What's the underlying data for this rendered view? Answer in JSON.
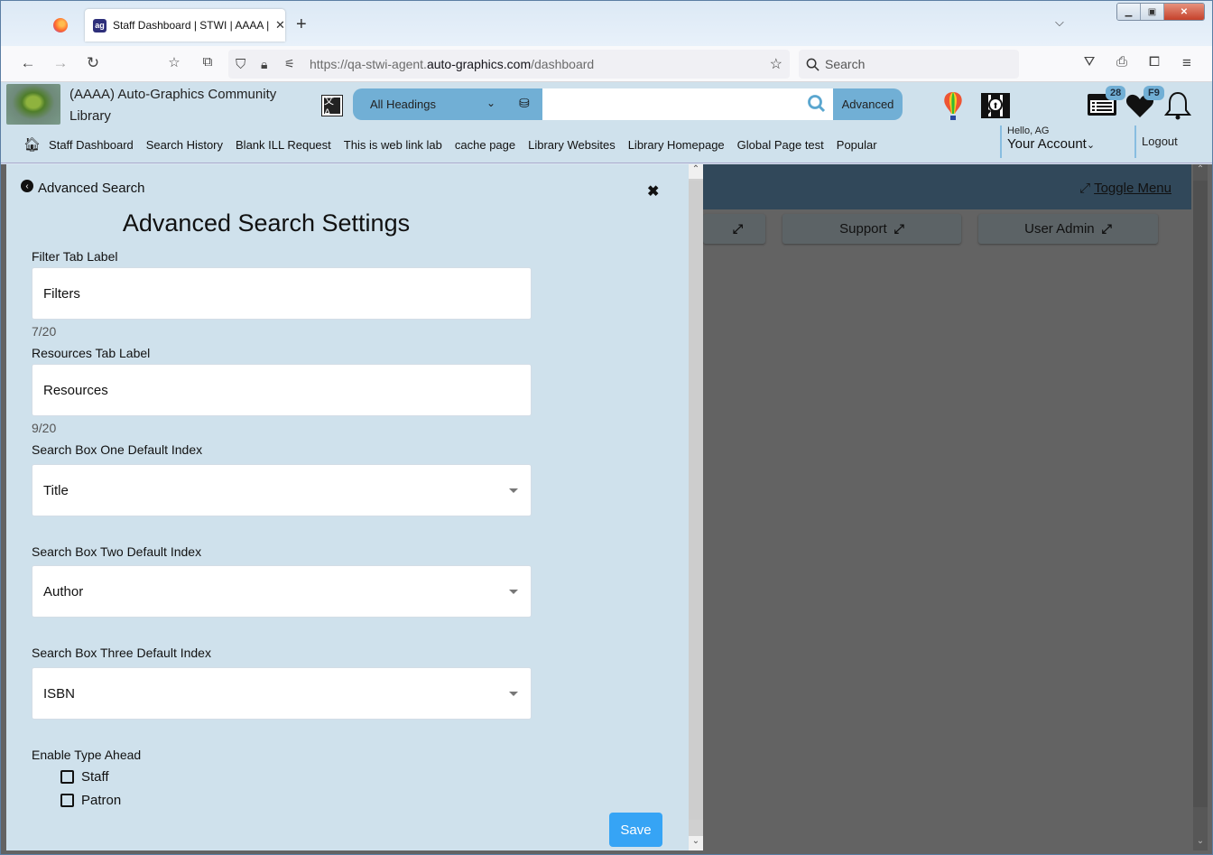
{
  "browser": {
    "tab_title": "Staff Dashboard | STWI | AAAA |",
    "url_prefix": "https://qa-stwi-agent.",
    "url_domain": "auto-graphics.com",
    "url_path": "/dashboard",
    "search_placeholder": "Search"
  },
  "header": {
    "library_name": "(AAAA) Auto-Graphics Community Library",
    "search_scope": "All Headings",
    "search_value": "",
    "advanced_label": "Advanced",
    "badges": {
      "list_count": "28",
      "favorites": "F9"
    },
    "menu": [
      "Staff Dashboard",
      "Search History",
      "Blank ILL Request",
      "This is web link lab",
      "cache page",
      "Library Websites",
      "Library Homepage",
      "Global Page test",
      "Popular"
    ],
    "greeting": "Hello, AG",
    "account_label": "Your Account",
    "logout_label": "Logout"
  },
  "panel": {
    "back_label": "Advanced Search",
    "title": "Advanced Search Settings",
    "filter_tab_label": "Filter Tab Label",
    "filter_tab_value": "Filters",
    "filter_counter": "7/20",
    "resources_tab_label": "Resources Tab Label",
    "resources_tab_value": "Resources",
    "resources_counter": "9/20",
    "box_one_label": "Search Box One Default Index",
    "box_one_value": "Title",
    "box_two_label": "Search Box Two Default Index",
    "box_two_value": "Author",
    "box_three_label": "Search Box Three Default Index",
    "box_three_value": "ISBN",
    "type_ahead_label": "Enable Type Ahead",
    "checkboxes": [
      {
        "label": "Staff",
        "checked": false
      },
      {
        "label": "Patron",
        "checked": false
      }
    ],
    "save_label": "Save"
  },
  "dashboard": {
    "toggle_menu": "Toggle Menu",
    "buttons": [
      "Support",
      "User Admin"
    ]
  }
}
